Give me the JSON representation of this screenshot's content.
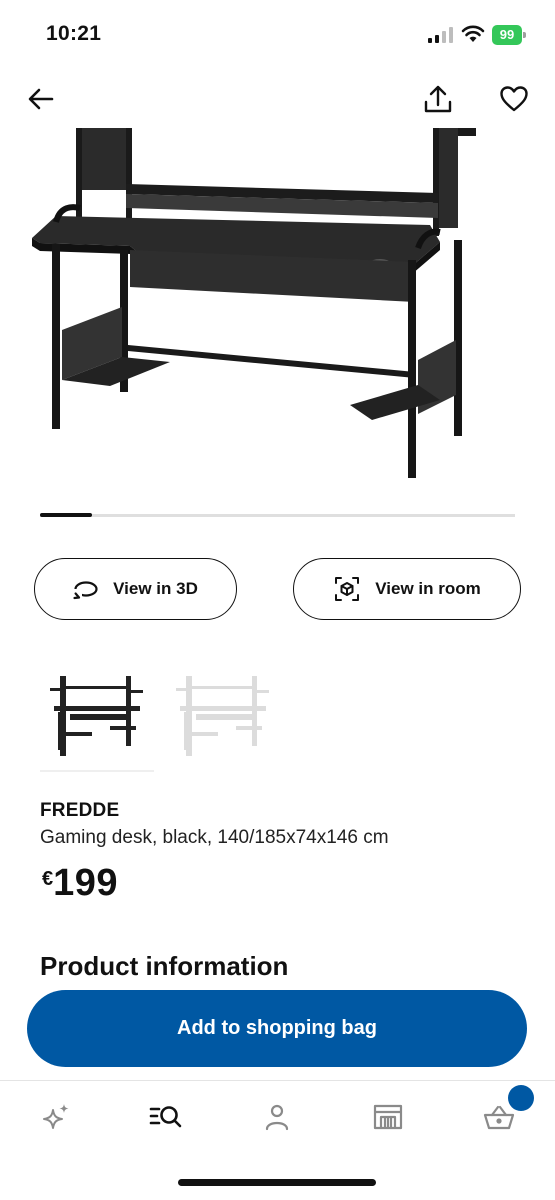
{
  "status_bar": {
    "time": "10:21",
    "battery": "99"
  },
  "header": {
    "back_icon": "arrow-left-icon",
    "share_icon": "share-icon",
    "favourite_icon": "heart-icon"
  },
  "gallery": {
    "image": "black-gaming-desk",
    "progress": 0.11
  },
  "actions": {
    "view_3d_label": "View in 3D",
    "view_room_label": "View in room"
  },
  "variants": [
    {
      "name": "black",
      "selected": true
    },
    {
      "name": "white",
      "selected": false
    }
  ],
  "product": {
    "name": "FREDDE",
    "description": "Gaming desk, black, 140/185x74x146 cm",
    "currency": "€",
    "price": "199"
  },
  "section": {
    "title": "Product information"
  },
  "cta": {
    "label": "Add to shopping bag",
    "color": "#0058a3"
  },
  "tab_bar": {
    "items": [
      {
        "icon": "sparkle-icon",
        "active": false
      },
      {
        "icon": "search-list-icon",
        "active": true
      },
      {
        "icon": "person-icon",
        "active": false
      },
      {
        "icon": "store-icon",
        "active": false
      },
      {
        "icon": "basket-icon",
        "active": false,
        "badge": true
      }
    ]
  }
}
